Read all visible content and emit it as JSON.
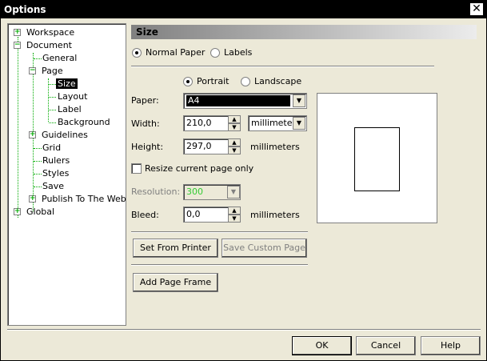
{
  "window": {
    "title": "Options",
    "close_glyph": "✕"
  },
  "tree": {
    "workspace": "Workspace",
    "document": "Document",
    "general": "General",
    "page": "Page",
    "size": "Size",
    "layout": "Layout",
    "label": "Label",
    "background": "Background",
    "guidelines": "Guidelines",
    "grid": "Grid",
    "rulers": "Rulers",
    "styles": "Styles",
    "save": "Save",
    "publish": "Publish To The Web",
    "global": "Global"
  },
  "panel": {
    "title": "Size",
    "normal_paper": "Normal Paper",
    "labels": "Labels",
    "portrait": "Portrait",
    "landscape": "Landscape",
    "paper_label": "Paper:",
    "paper_value": "A4",
    "width_label": "Width:",
    "width_value": "210,0",
    "width_unit": "millimeters",
    "height_label": "Height:",
    "height_value": "297,0",
    "height_unit": "millimeters",
    "resize_only": "Resize current page only",
    "resolution_label": "Resolution:",
    "resolution_value": "300",
    "bleed_label": "Bleed:",
    "bleed_value": "0,0",
    "bleed_unit": "millimeters",
    "set_from_printer": "Set From Printer",
    "save_custom_page": "Save Custom Page",
    "add_page_frame": "Add Page Frame"
  },
  "footer": {
    "ok": "OK",
    "cancel": "Cancel",
    "help": "Help"
  },
  "colors": {
    "tree_accent": "#00aa00",
    "resolution_text": "#33cc33"
  }
}
